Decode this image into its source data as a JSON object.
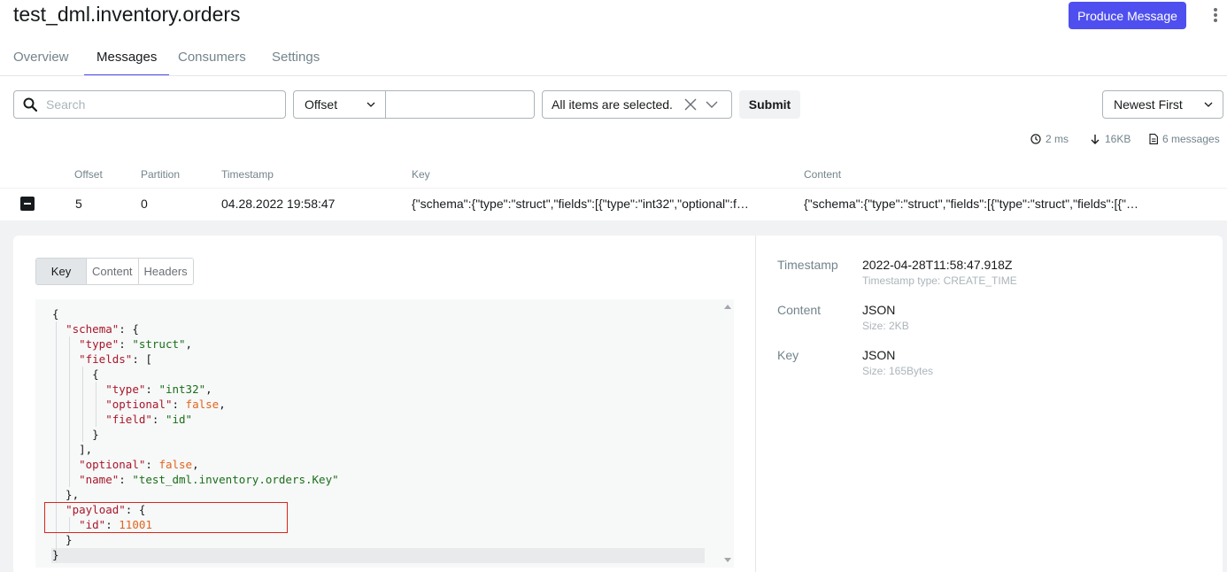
{
  "header": {
    "title": "test_dml.inventory.orders",
    "produce_label": "Produce Message"
  },
  "tabs": [
    {
      "label": "Overview"
    },
    {
      "label": "Messages"
    },
    {
      "label": "Consumers"
    },
    {
      "label": "Settings"
    }
  ],
  "filters": {
    "search_placeholder": "Search",
    "seek_type": "Offset",
    "seek_value": "",
    "partitions": "All items are selected.",
    "submit_label": "Submit",
    "sort": "Newest First"
  },
  "stats": {
    "time": "2 ms",
    "bytes": "16KB",
    "count": "6 messages"
  },
  "table": {
    "headers": [
      "Offset",
      "Partition",
      "Timestamp",
      "Key",
      "Content"
    ],
    "rows": [
      {
        "offset": "5",
        "partition": "0",
        "timestamp": "04.28.2022 19:58:47",
        "key": "{\"schema\":{\"type\":\"struct\",\"fields\":[{\"type\":\"int32\",\"optional\":f…",
        "content": "{\"schema\":{\"type\":\"struct\",\"fields\":[{\"type\":\"struct\",\"fields\":[{\"…"
      }
    ]
  },
  "detail": {
    "view_tabs": [
      "Key",
      "Content",
      "Headers"
    ],
    "active_view": "Key",
    "metadata": [
      {
        "label": "Timestamp",
        "value": "2022-04-28T11:58:47.918Z",
        "sub": "Timestamp type: CREATE_TIME"
      },
      {
        "label": "Content",
        "value": "JSON",
        "sub": "Size: 2KB"
      },
      {
        "label": "Key",
        "value": "JSON",
        "sub": "Size: 165Bytes"
      }
    ]
  },
  "colors": {
    "accent": "#4f4ff0",
    "json_key": "#a8172a",
    "json_string": "#1a6e1a",
    "json_number": "#e0651f",
    "highlight_border": "#d9261c"
  },
  "icons": [
    "search-icon",
    "chevron-down-icon",
    "clear-icon",
    "clock-icon",
    "arrow-down-icon",
    "file-icon",
    "more-vertical-icon",
    "collapse-icon"
  ]
}
